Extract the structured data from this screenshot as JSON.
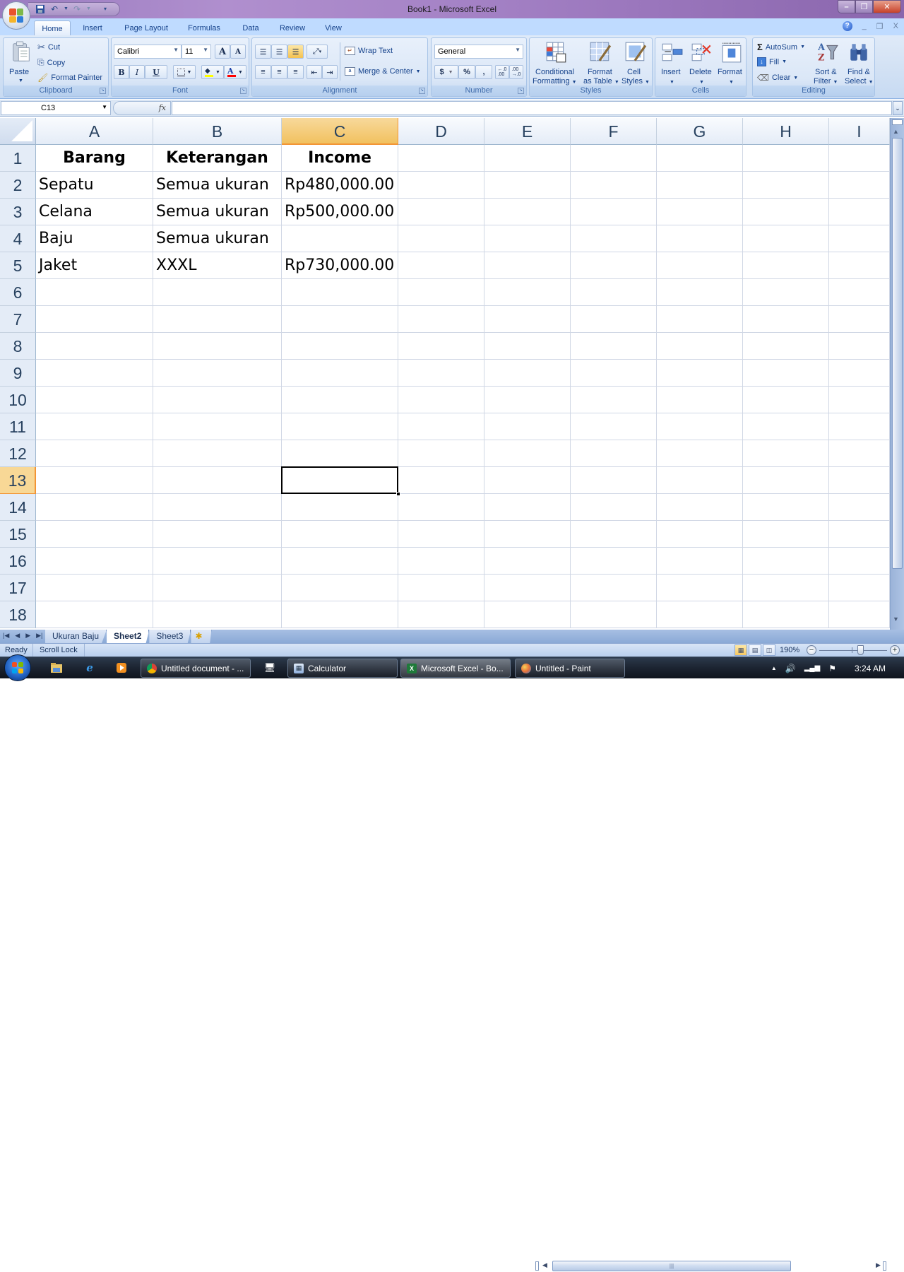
{
  "window": {
    "title": "Book1 - Microsoft Excel",
    "controls": {
      "minimize": "–",
      "restore": "❐",
      "close": "✕"
    }
  },
  "quick_access": {
    "save": "save-icon",
    "undo": "undo-icon",
    "redo": "redo-icon",
    "customize": "customize-icon"
  },
  "ribbon_tabs": [
    {
      "label": "Home",
      "active": true
    },
    {
      "label": "Insert"
    },
    {
      "label": "Page Layout"
    },
    {
      "label": "Formulas"
    },
    {
      "label": "Data"
    },
    {
      "label": "Review"
    },
    {
      "label": "View"
    }
  ],
  "help": {
    "help_icon": "?",
    "minimize": "_",
    "restore": "❐",
    "close": "X"
  },
  "ribbon": {
    "clipboard": {
      "label": "Clipboard",
      "paste": "Paste",
      "cut": "Cut",
      "copy": "Copy",
      "format_painter": "Format Painter"
    },
    "font": {
      "label": "Font",
      "font_name": "Calibri",
      "font_size": "11",
      "grow": "A",
      "shrink": "A",
      "bold": "B",
      "italic": "I",
      "underline": "U",
      "highlight_color": "#ffff00",
      "font_color": "#ff0000"
    },
    "alignment": {
      "label": "Alignment",
      "wrap_text": "Wrap Text",
      "merge_center": "Merge & Center"
    },
    "number": {
      "label": "Number",
      "format": "General",
      "currency": "$",
      "percent": "%",
      "comma": ",",
      "inc_decimal": "+.0 .00",
      "dec_decimal": ".00 →.0"
    },
    "styles": {
      "label": "Styles",
      "conditional_1": "Conditional",
      "conditional_2": "Formatting",
      "format_table_1": "Format",
      "format_table_2": "as Table",
      "cell_styles_1": "Cell",
      "cell_styles_2": "Styles"
    },
    "cells": {
      "label": "Cells",
      "insert": "Insert",
      "delete": "Delete",
      "format": "Format"
    },
    "editing": {
      "label": "Editing",
      "autosum": "AutoSum",
      "fill": "Fill",
      "clear": "Clear",
      "sort_1": "Sort &",
      "sort_2": "Filter",
      "find_1": "Find &",
      "find_2": "Select"
    }
  },
  "formula_bar": {
    "name_box": "C13",
    "fx": "fx",
    "value": ""
  },
  "sheet": {
    "columns": [
      "A",
      "B",
      "C",
      "D",
      "E",
      "F",
      "G",
      "H",
      "I"
    ],
    "selected_column": "C",
    "rows": [
      "1",
      "2",
      "3",
      "4",
      "5",
      "6",
      "7",
      "8",
      "9",
      "10",
      "11",
      "12",
      "13",
      "14",
      "15",
      "16",
      "17",
      "18"
    ],
    "selected_row": "13",
    "active_cell": "C13",
    "cells": [
      [
        "Barang",
        "Keterangan",
        "Income"
      ],
      [
        "Sepatu",
        "Semua ukuran",
        "Rp480,000.00"
      ],
      [
        "Celana",
        "Semua ukuran",
        "Rp500,000.00"
      ],
      [
        "Baju",
        "Semua ukuran",
        ""
      ],
      [
        "Jaket",
        "XXXL",
        "Rp730,000.00"
      ]
    ]
  },
  "sheet_tabs": [
    {
      "label": "Ukuran Baju"
    },
    {
      "label": "Sheet2",
      "active": true
    },
    {
      "label": "Sheet3"
    }
  ],
  "status": {
    "mode": "Ready",
    "scroll_lock": "Scroll Lock",
    "zoom": "190%",
    "zoom_minus": "−",
    "zoom_plus": "+"
  },
  "taskbar": {
    "windows": [
      {
        "label": "Untitled document - ...",
        "icon": "chrome-icon"
      },
      {
        "label": "Calculator",
        "icon": "calculator-icon"
      },
      {
        "label": "Microsoft Excel - Bo...",
        "icon": "excel-icon",
        "active": true
      },
      {
        "label": "Untitled - Paint",
        "icon": "paint-icon"
      }
    ],
    "clock": "3:24 AM"
  }
}
